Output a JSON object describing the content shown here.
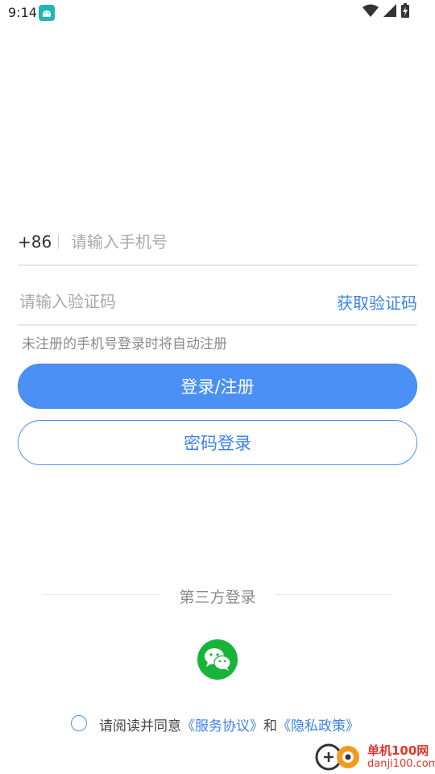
{
  "status_bar": {
    "time": "9:14",
    "app_icon": "android-robot-icon",
    "wifi_icon": "wifi-icon",
    "signal_icon": "cell-signal-icon",
    "battery_icon": "battery-charging-icon"
  },
  "login_form": {
    "country_code": "+86",
    "phone_placeholder": "请输入手机号",
    "phone_value": "",
    "code_placeholder": "请输入验证码",
    "code_value": "",
    "get_code_label": "获取验证码",
    "hint": "未注册的手机号登录时将自动注册",
    "primary_button_label": "登录/注册",
    "password_login_label": "密码登录"
  },
  "third_party": {
    "label": "第三方登录",
    "wechat_icon": "wechat-icon"
  },
  "agreement": {
    "prefix": "请阅读并同意",
    "service_link": "《服务协议》",
    "conjunction": "和",
    "privacy_link": "《隐私政策》",
    "checked": false
  },
  "watermark": {
    "title": "单机100网",
    "url": "danji100.com"
  },
  "colors": {
    "accent": "#4a90f5",
    "link": "#3b82e8",
    "wechat": "#18b43a",
    "watermark": "#e0362a"
  }
}
